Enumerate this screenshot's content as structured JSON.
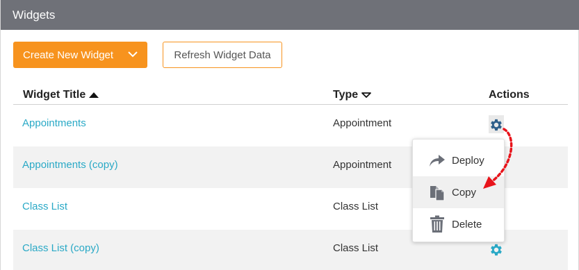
{
  "panel": {
    "title": "Widgets"
  },
  "toolbar": {
    "create_label": "Create New Widget",
    "refresh_label": "Refresh Widget Data"
  },
  "table": {
    "columns": [
      {
        "label": "Widget Title",
        "sort": "ascending"
      },
      {
        "label": "Type",
        "sort": "descending"
      },
      {
        "label": "Actions"
      }
    ],
    "rows": [
      {
        "title": "Appointments",
        "type": "Appointment"
      },
      {
        "title": "Appointments (copy)",
        "type": "Appointment"
      },
      {
        "title": "Class List",
        "type": "Class List"
      },
      {
        "title": "Class List (copy)",
        "type": "Class List"
      }
    ]
  },
  "actions_menu": {
    "items": [
      {
        "label": "Deploy",
        "icon": "deploy-arrow-icon"
      },
      {
        "label": "Copy",
        "icon": "copy-icon"
      },
      {
        "label": "Delete",
        "icon": "trash-icon"
      }
    ]
  },
  "annotation": {
    "icon": "red-dotted-arrow-icon",
    "color": "#e8141b"
  },
  "colors": {
    "header_bg": "#6f7178",
    "accent_orange": "#f7931e",
    "link_teal": "#2aa9c6",
    "gear_active": "#2f5f8a",
    "gear_teal": "#2aa9c6"
  }
}
